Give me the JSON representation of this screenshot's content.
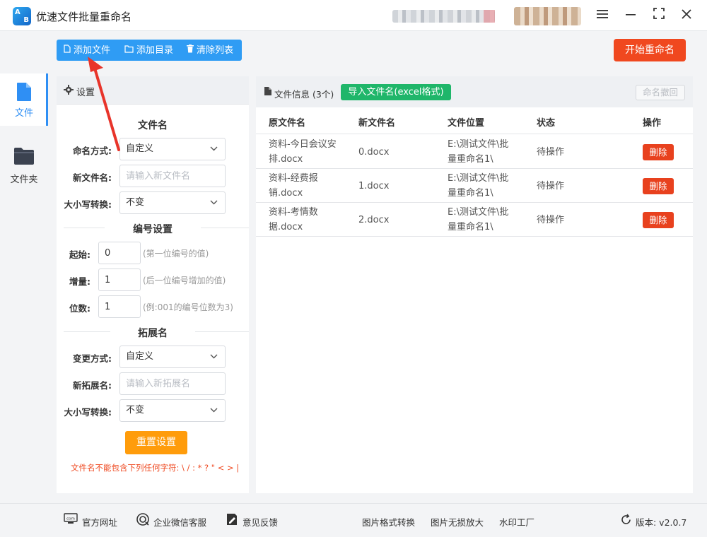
{
  "window": {
    "logo_text_top": "A",
    "logo_text_bottom": "B",
    "title": "优速文件批量重命名",
    "menu_icon": "menu-icon",
    "minimize_icon": "minimize-icon",
    "maximize_icon": "maximize-icon",
    "close_icon": "close-icon"
  },
  "toolbar": {
    "add_file": "添加文件",
    "add_dir": "添加目录",
    "clear_list": "清除列表",
    "start_rename": "开始重命名"
  },
  "nav": {
    "items": [
      {
        "label": "文件",
        "icon": "file-icon",
        "active": true
      },
      {
        "label": "文件夹",
        "icon": "folder-icon",
        "active": false
      }
    ]
  },
  "settings": {
    "header": "设置",
    "filename_section": "文件名",
    "naming_mode_label": "命名方式:",
    "naming_mode_value": "自定义",
    "new_name_label": "新文件名:",
    "new_name_placeholder": "请输入新文件名",
    "case_label": "大小写转换:",
    "case_value": "不变",
    "numbering_section": "编号设置",
    "start_label": "起始:",
    "start_value": "0",
    "start_hint": "(第一位编号的值)",
    "step_label": "增量:",
    "step_value": "1",
    "step_hint": "(后一位编号增加的值)",
    "digits_label": "位数:",
    "digits_value": "1",
    "digits_hint": "(例:001的编号位数为3)",
    "ext_section": "拓展名",
    "ext_mode_label": "变更方式:",
    "ext_mode_value": "自定义",
    "new_ext_label": "新拓展名:",
    "new_ext_placeholder": "请输入新拓展名",
    "ext_case_label": "大小写转换:",
    "ext_case_value": "不变",
    "reset": "重置设置",
    "warning": "文件名不能包含下列任何字符: \\ / : * ? \" < > |"
  },
  "files": {
    "header": "文件信息",
    "count": "(3个)",
    "import_btn": "导入文件名(excel格式)",
    "undo_btn": "命名撤回",
    "columns": [
      "原文件名",
      "新文件名",
      "文件位置",
      "状态",
      "操作"
    ],
    "rows": [
      {
        "orig": "资料-今日会议安排.docx",
        "new": "0.docx",
        "path": "E:\\测试文件\\批量重命名1\\",
        "status": "待操作",
        "action": "删除"
      },
      {
        "orig": "资料-经费报销.docx",
        "new": "1.docx",
        "path": "E:\\测试文件\\批量重命名1\\",
        "status": "待操作",
        "action": "删除"
      },
      {
        "orig": "资料-考情数据.docx",
        "new": "2.docx",
        "path": "E:\\测试文件\\批量重命名1\\",
        "status": "待操作",
        "action": "删除"
      }
    ]
  },
  "footer": {
    "website": "官方网址",
    "wechat": "企业微信客服",
    "feedback": "意见反馈",
    "img_convert": "图片格式转换",
    "img_enlarge": "图片无损放大",
    "watermark": "水印工厂",
    "version": "版本: v2.0.7"
  },
  "colors": {
    "primary": "#2f9cf4",
    "start": "#f0481f",
    "import": "#1fb66a",
    "reset": "#ff9c0b",
    "delete": "#e8411e"
  }
}
